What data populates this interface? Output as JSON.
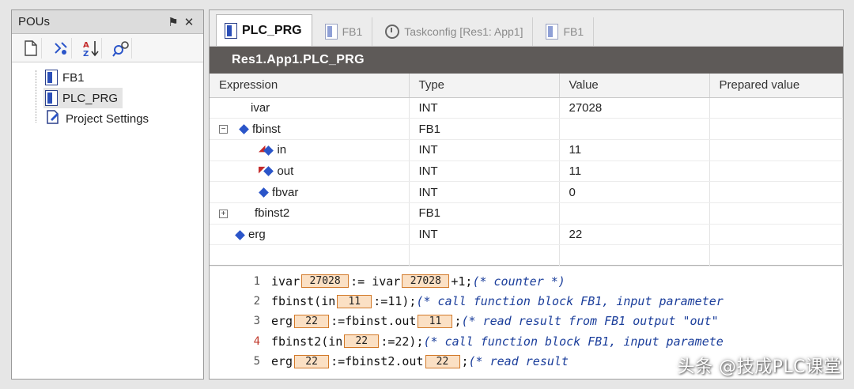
{
  "pou_panel": {
    "title": "POUs",
    "pin_glyph": "⚑",
    "close_glyph": "✕",
    "toolbar": [
      {
        "name": "new-object-icon"
      },
      {
        "name": "properties-icon"
      },
      {
        "name": "sort-az-icon"
      },
      {
        "name": "find-icon"
      }
    ],
    "tree": [
      {
        "label": "FB1",
        "icon": "function-block-icon",
        "selected": false
      },
      {
        "label": "PLC_PRG",
        "icon": "program-icon",
        "selected": true
      },
      {
        "label": "Project Settings",
        "icon": "project-settings-icon",
        "selected": false
      }
    ]
  },
  "tabs": [
    {
      "label": "PLC_PRG",
      "icon": "program-icon",
      "active": true
    },
    {
      "label": "FB1",
      "icon": "function-block-icon",
      "active": false
    },
    {
      "label": "Taskconfig [Res1: App1]",
      "icon": "task-config-icon",
      "active": false
    },
    {
      "label": "FB1",
      "icon": "function-block-icon",
      "active": false
    }
  ],
  "document_title": "Res1.App1.PLC_PRG",
  "watch": {
    "columns": [
      "Expression",
      "Type",
      "Value",
      "Prepared value"
    ],
    "rows": [
      {
        "expression": "ivar",
        "type": "INT",
        "value": "27028",
        "prepared": "",
        "indent": 0,
        "expander": "",
        "marker": "none"
      },
      {
        "expression": "fbinst",
        "type": "FB1",
        "value": "",
        "prepared": "",
        "indent": 0,
        "expander": "⊟",
        "marker": "diamond"
      },
      {
        "expression": "in",
        "type": "INT",
        "value": "11",
        "prepared": "",
        "indent": 1,
        "expander": "",
        "marker": "input"
      },
      {
        "expression": "out",
        "type": "INT",
        "value": "11",
        "prepared": "",
        "indent": 1,
        "expander": "",
        "marker": "output"
      },
      {
        "expression": "fbvar",
        "type": "INT",
        "value": "0",
        "prepared": "",
        "indent": 1,
        "expander": "",
        "marker": "diamond"
      },
      {
        "expression": "fbinst2",
        "type": "FB1",
        "value": "",
        "prepared": "",
        "indent": 0,
        "expander": "⊞",
        "marker": "none"
      },
      {
        "expression": "erg",
        "type": "INT",
        "value": "22",
        "prepared": "",
        "indent": 0,
        "expander": "",
        "marker": "diamond"
      },
      {
        "expression": "",
        "type": "",
        "value": "",
        "prepared": "",
        "indent": 0,
        "expander": "",
        "marker": "none"
      }
    ]
  },
  "code": {
    "lines": [
      {
        "num": "1",
        "parts": [
          {
            "t": "kw",
            "v": "ivar"
          },
          {
            "t": "mon",
            "v": "27028"
          },
          {
            "t": "op",
            "v": " := ivar"
          },
          {
            "t": "mon",
            "v": "27028"
          },
          {
            "t": "op",
            "v": "+1; "
          },
          {
            "t": "cmt",
            "v": "(* counter *)"
          }
        ]
      },
      {
        "num": "2",
        "parts": [
          {
            "t": "kw",
            "v": "fbinst(in"
          },
          {
            "t": "mon",
            "v": "11"
          },
          {
            "t": "op",
            "v": ":=11); "
          },
          {
            "t": "cmt",
            "v": "(* call function block FB1, input parameter"
          }
        ]
      },
      {
        "num": "3",
        "parts": [
          {
            "t": "kw",
            "v": "erg"
          },
          {
            "t": "mon",
            "v": "22"
          },
          {
            "t": "op",
            "v": ":=fbinst.out"
          },
          {
            "t": "mon",
            "v": "11"
          },
          {
            "t": "op",
            "v": "; "
          },
          {
            "t": "cmt",
            "v": "(* read result from FB1 output \"out\""
          }
        ]
      },
      {
        "num": "4",
        "bp": true,
        "parts": [
          {
            "t": "kw",
            "v": "fbinst2(in"
          },
          {
            "t": "mon",
            "v": "22"
          },
          {
            "t": "op",
            "v": ":=22); "
          },
          {
            "t": "cmt",
            "v": "(* call function block FB1, input paramete"
          }
        ]
      },
      {
        "num": "5",
        "parts": [
          {
            "t": "kw",
            "v": "erg"
          },
          {
            "t": "mon",
            "v": "22"
          },
          {
            "t": "op",
            "v": ":=fbinst2.out"
          },
          {
            "t": "mon",
            "v": "22"
          },
          {
            "t": "op",
            "v": "; "
          },
          {
            "t": "cmt",
            "v": "(* read result"
          }
        ]
      }
    ]
  },
  "watermark": "头条 @技成PLC课堂",
  "colors": {
    "title_bar": "#5e5a58",
    "monitor_fill": "#fbe0c4",
    "monitor_border": "#d27a2a",
    "comment": "#1b3e9b",
    "accent_blue": "#2b55c9"
  }
}
